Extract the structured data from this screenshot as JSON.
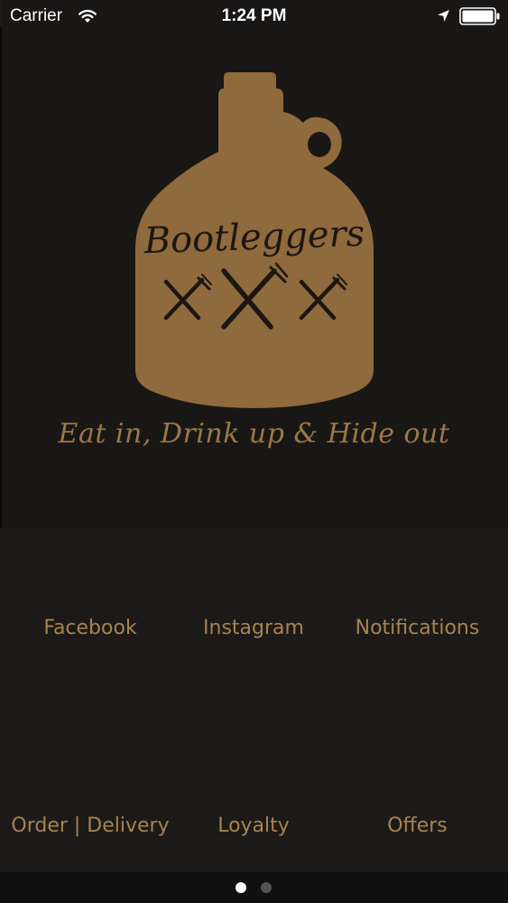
{
  "status_bar": {
    "carrier": "Carrier",
    "time": "1:24 PM",
    "icons": [
      "wifi-icon",
      "location-arrow-icon",
      "battery-icon"
    ]
  },
  "logo": {
    "brand": "Bootleggers",
    "icon": "jug-with-crossed-knives-and-forks-logo"
  },
  "tagline": "Eat in, Drink up & Hide out",
  "menu": {
    "facebook": "Facebook",
    "instagram": "Instagram",
    "notifications": "Notifications",
    "order_delivery": "Order | Delivery",
    "loyalty": "Loyalty",
    "offers": "Offers"
  },
  "page_control": {
    "total_pages": 2,
    "current_page": 1
  },
  "colors": {
    "background": "#1c1a19",
    "accent_gold": "#a6834f",
    "jug_brown": "#8e6a3c"
  }
}
